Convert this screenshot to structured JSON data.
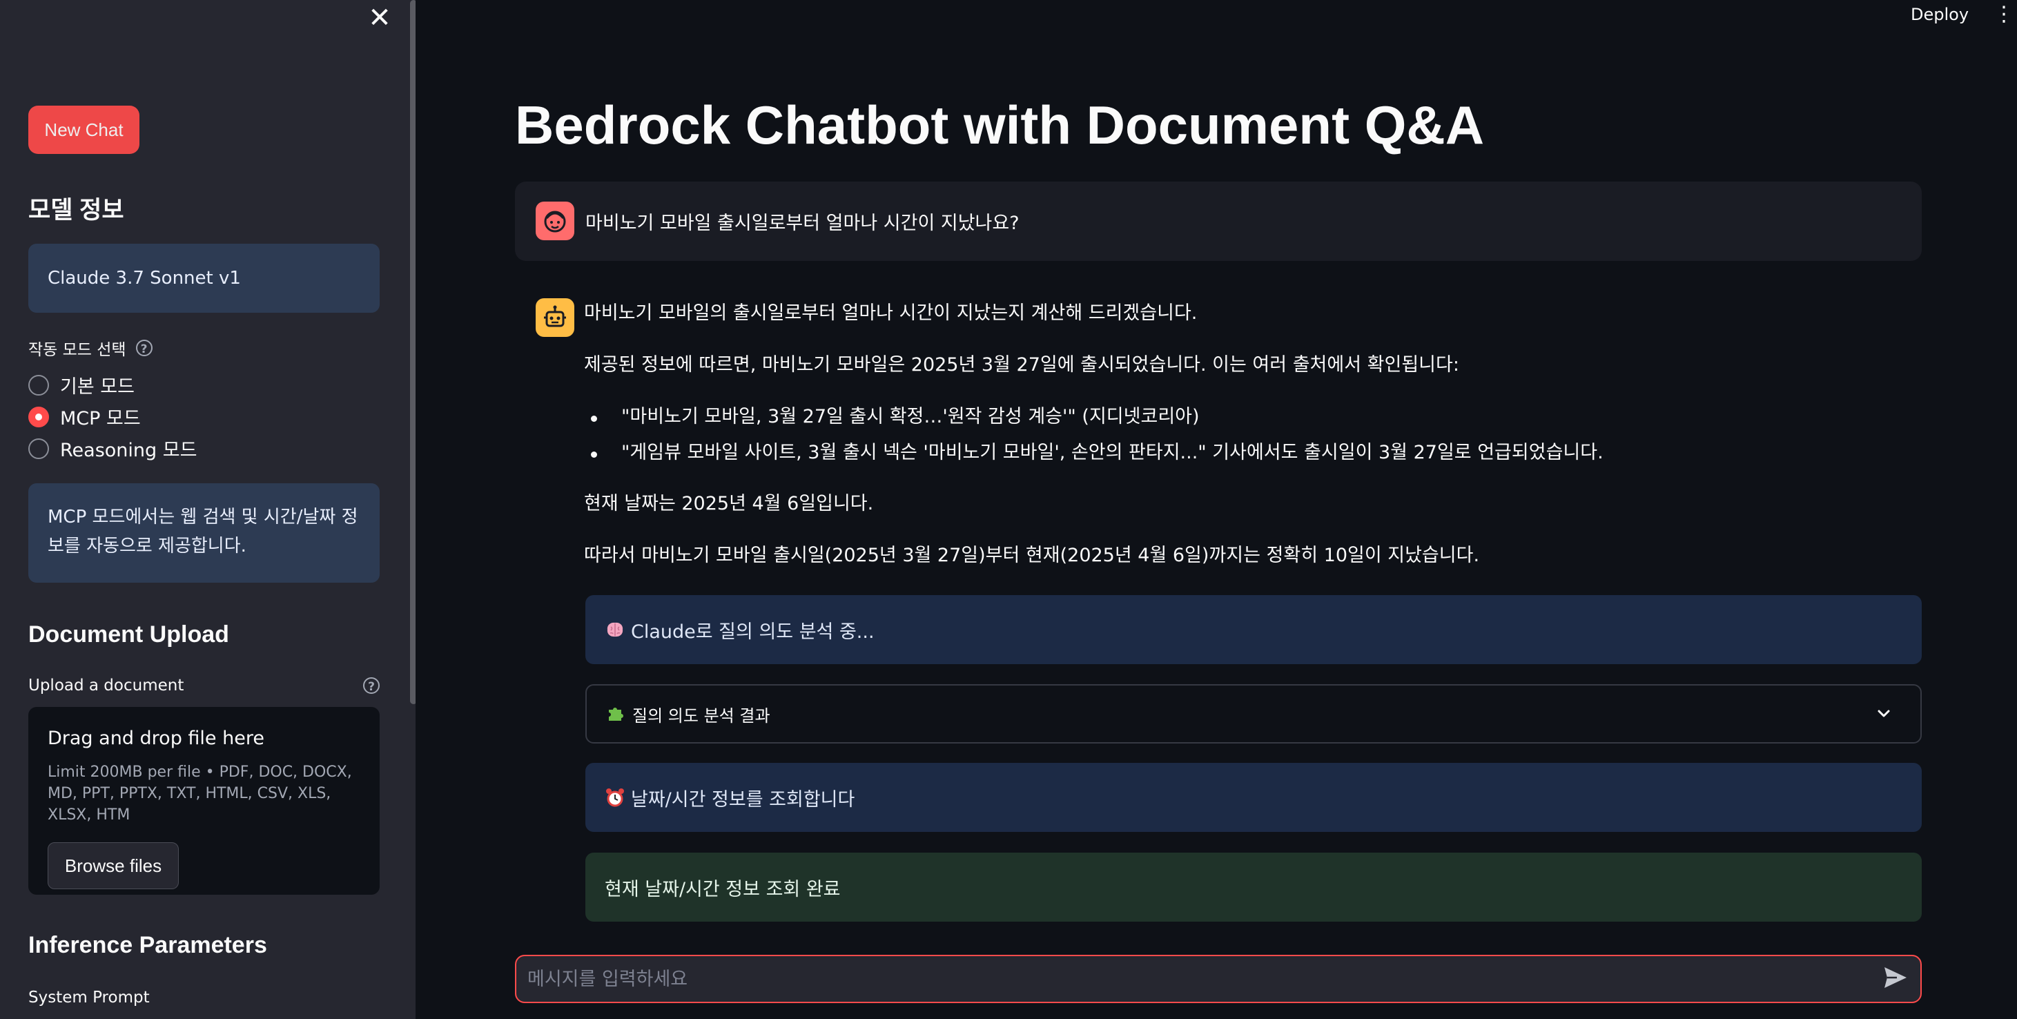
{
  "header": {
    "deploy_label": "Deploy"
  },
  "sidebar": {
    "new_chat_label": "New Chat",
    "model_section_title": "모델 정보",
    "model_name": "Claude 3.7 Sonnet v1",
    "mode_label": "작동 모드 선택",
    "modes": [
      {
        "label": "기본 모드",
        "selected": false
      },
      {
        "label": "MCP 모드",
        "selected": true
      },
      {
        "label": "Reasoning 모드",
        "selected": false
      }
    ],
    "mode_info": "MCP 모드에서는 웹 검색 및 시간/날짜 정보를 자동으로 제공합니다.",
    "upload_section_title": "Document Upload",
    "upload_label": "Upload a document",
    "upload_drag_text": "Drag and drop file here",
    "upload_limit_text": "Limit 200MB per file • PDF, DOC, DOCX, MD, PPT, PPTX, TXT, HTML, CSV, XLS, XLSX, HTM",
    "browse_label": "Browse files",
    "inference_title": "Inference Parameters",
    "system_prompt_label": "System Prompt"
  },
  "main": {
    "title": "Bedrock Chatbot with Document Q&A",
    "user_message": "마비노기 모바일 출시일로부터 얼마나 시간이 지났나요?",
    "assistant": {
      "intro": "마비노기 모바일의 출시일로부터 얼마나 시간이 지났는지 계산해 드리겠습니다.",
      "info_line": "제공된 정보에 따르면, 마비노기 모바일은 2025년 3월 27일에 출시되었습니다. 이는 여러 출처에서 확인됩니다:",
      "bullets": [
        "\"마비노기 모바일, 3월 27일 출시 확정…'원작 감성 계승'\" (지디넷코리아)",
        "\"게임뷰 모바일 사이트, 3월 출시 넥슨 '마비노기 모바일', 손안의 판타지...\" 기사에서도 출시일이 3월 27일로 언급되었습니다."
      ],
      "current_date": "현재 날짜는 2025년 4월 6일입니다.",
      "conclusion": "따라서 마비노기 모바일 출시일(2025년 3월 27일)부터 현재(2025년 4월 6일)까지는 정확히 10일이 지났습니다."
    },
    "status_analyzing": "Claude로 질의 의도 분석 중...",
    "expander_label": "질의 의도 분석 결과",
    "status_datetime": "날짜/시간 정보를 조회합니다",
    "status_done": "현재 날짜/시간 정보 조회 완료",
    "input_placeholder": "메시지를 입력하세요"
  },
  "colors": {
    "accent": "#ff4b4b",
    "background": "#0e1117",
    "sidebar": "#262730",
    "info_box": "#1c2a45",
    "success_box": "#1f3329"
  },
  "icons": [
    "close-icon",
    "help-icon",
    "user-avatar-icon",
    "bot-avatar-icon",
    "brain-icon",
    "puzzle-icon",
    "alarm-clock-icon",
    "chevron-down-icon",
    "send-icon",
    "kebab-menu-icon"
  ]
}
